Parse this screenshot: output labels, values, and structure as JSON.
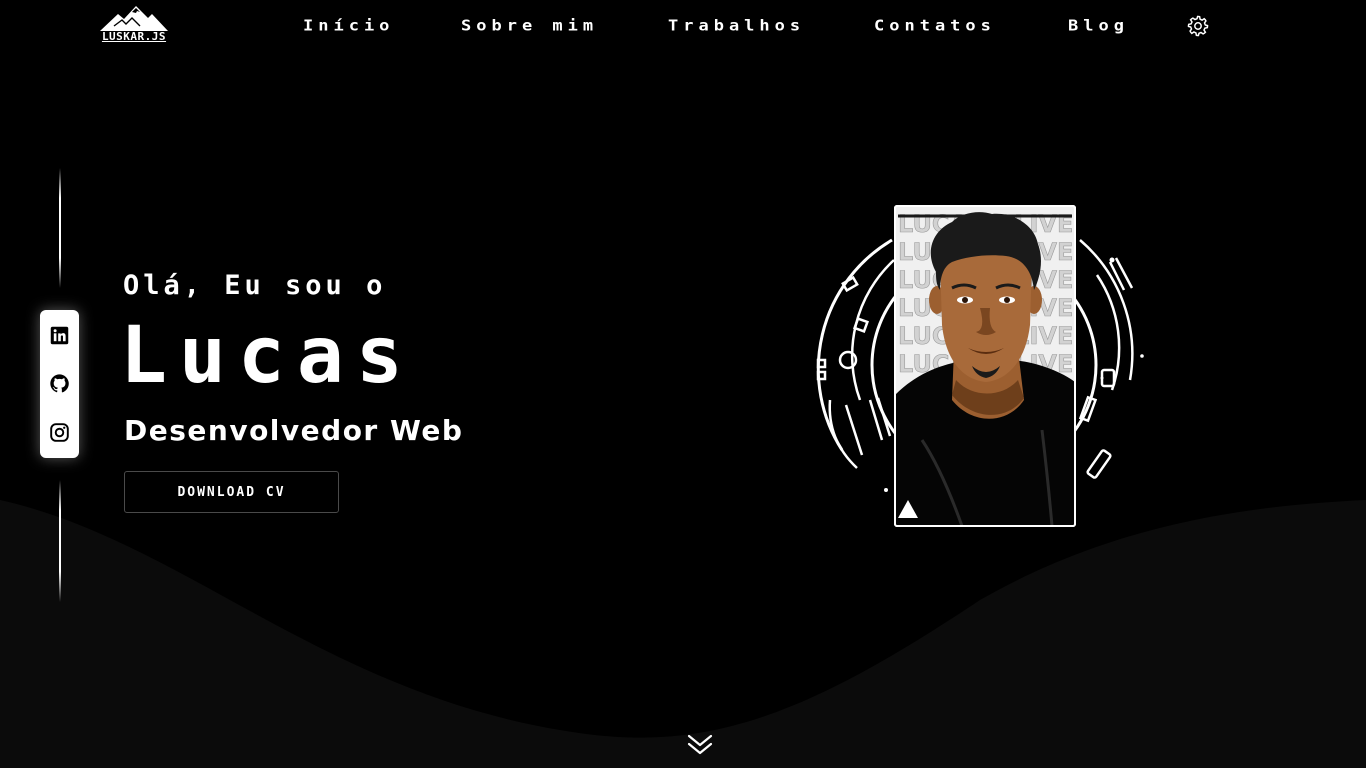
{
  "header": {
    "logo_text": "LUSKAR.JS",
    "nav": [
      {
        "label": "Início"
      },
      {
        "label": "Sobre mim"
      },
      {
        "label": "Trabalhos"
      },
      {
        "label": "Contatos"
      },
      {
        "label": "Blog"
      }
    ],
    "settings_icon": "gear-icon"
  },
  "sidebar": {
    "icons": [
      "linkedin-icon",
      "github-icon",
      "instagram-icon"
    ]
  },
  "hero": {
    "greeting": "Olá, Eu sou o",
    "name": "Lucas",
    "role": "Desenvolvedor Web",
    "cv_button": "DOWNLOAD CV"
  },
  "portrait": {
    "background_word": "LUCAS OLIVEIRA"
  },
  "scroll_icon": "double-chevron-down-icon",
  "colors": {
    "background": "#000000",
    "wave": "#0b0b0b",
    "text": "#ffffff",
    "skin": "#a86a3a"
  }
}
